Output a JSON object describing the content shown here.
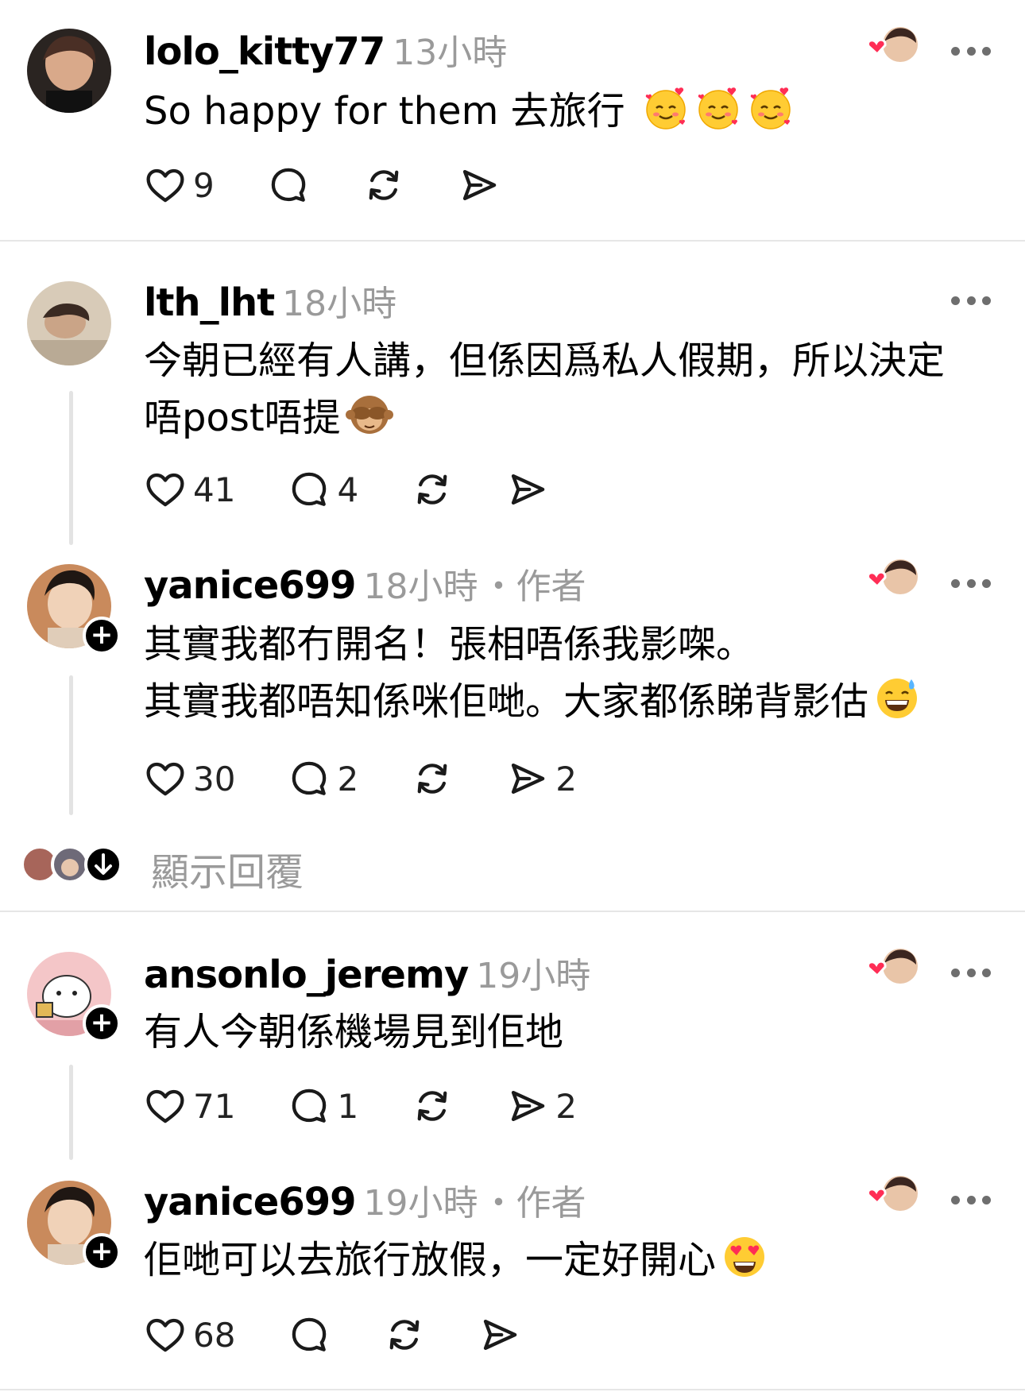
{
  "posts": [
    {
      "username": "lolo_kitty77",
      "time": "13小時",
      "author_tag": "",
      "text_lines": [
        "So happy for them 去旅行"
      ],
      "likes": "9",
      "replies": "",
      "shares": ""
    },
    {
      "username": "lth_lht",
      "time": "18小時",
      "author_tag": "",
      "text_lines": [
        "今朝已經有人講，但係因爲私人假期，所以決定",
        "唔post唔提"
      ],
      "likes": "41",
      "replies": "4",
      "shares": ""
    },
    {
      "username": "yanice699",
      "time": "18小時",
      "author_tag": "・作者",
      "text_lines": [
        "其實我都冇開名！張相唔係我影㗎。",
        "其實我都唔知係咪佢哋。大家都係睇背影估"
      ],
      "likes": "30",
      "replies": "2",
      "shares": "2"
    },
    {
      "username": "ansonlo_jeremy",
      "time": "19小時",
      "author_tag": "",
      "text_lines": [
        "有人今朝係機場見到佢地"
      ],
      "likes": "71",
      "replies": "1",
      "shares": "2"
    },
    {
      "username": "yanice699",
      "time": "19小時",
      "author_tag": "・作者",
      "text_lines": [
        "佢哋可以去旅行放假，一定好開心"
      ],
      "likes": "68",
      "replies": "",
      "shares": ""
    }
  ],
  "show_replies_label": "顯示回覆",
  "icons": {
    "like": "heart-icon",
    "reply": "comment-bubble-icon",
    "repost": "repost-icon",
    "share": "send-icon",
    "more": "more-dots-icon",
    "liked_by_author": "heart-with-avatar-icon",
    "follow": "plus-icon",
    "expand": "arrow-down-icon"
  },
  "colors": {
    "heart_red": "#ff2d55",
    "meta_gray": "#9a9a9a",
    "divider": "#e6e6e6"
  }
}
